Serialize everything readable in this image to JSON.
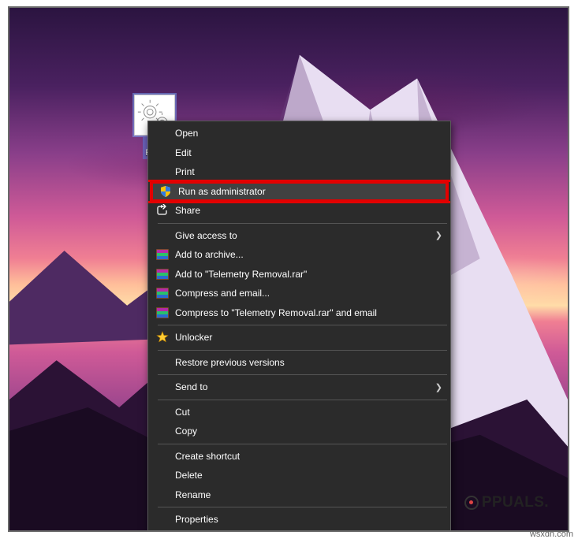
{
  "desktop": {
    "icon_label": "Tel\nRem"
  },
  "context_menu": {
    "open": "Open",
    "edit": "Edit",
    "print": "Print",
    "run_as_admin": "Run as administrator",
    "share": "Share",
    "give_access_to": "Give access to",
    "add_to_archive": "Add to archive...",
    "add_to_named": "Add to \"Telemetry Removal.rar\"",
    "compress_email": "Compress and email...",
    "compress_named_email": "Compress to \"Telemetry Removal.rar\" and email",
    "unlocker": "Unlocker",
    "restore_versions": "Restore previous versions",
    "send_to": "Send to",
    "cut": "Cut",
    "copy": "Copy",
    "create_shortcut": "Create shortcut",
    "delete": "Delete",
    "rename": "Rename",
    "properties": "Properties"
  },
  "brand": {
    "text": "PPUALS."
  },
  "watermark": "wsxdn.com"
}
